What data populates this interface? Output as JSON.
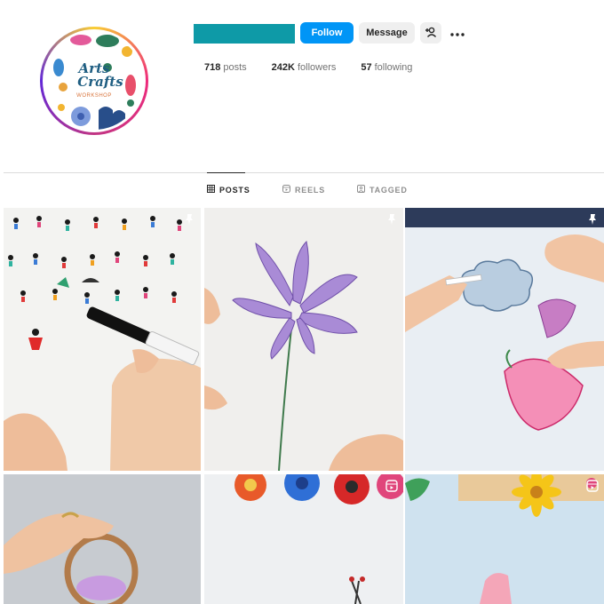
{
  "profile": {
    "avatar_lines": [
      "Arts",
      "Crafts"
    ],
    "avatar_sub": "WORKSHOP",
    "username_color": "#0e9aa7"
  },
  "actions": {
    "follow_label": "Follow",
    "message_label": "Message",
    "add_user_icon": "add-user-icon",
    "more_icon": "more-icon"
  },
  "stats": {
    "posts": {
      "value": "718",
      "label": "posts"
    },
    "followers": {
      "value": "242K",
      "label": "followers"
    },
    "following": {
      "value": "57",
      "label": "following"
    }
  },
  "tabs": [
    {
      "label": "POSTS",
      "icon": "grid-icon",
      "active": true
    },
    {
      "label": "REELS",
      "icon": "reels-icon",
      "active": false
    },
    {
      "label": "TAGGED",
      "icon": "tagged-icon",
      "active": false
    }
  ],
  "posts": [
    {
      "subject": "hand drawing tiny figures with pen",
      "badge": "pin-icon"
    },
    {
      "subject": "purple lily pencil drawing",
      "badge": "pin-icon"
    },
    {
      "subject": "colored pencil clouds and pink flower",
      "badge": "pin-icon"
    },
    {
      "subject": "hand holding paper roll",
      "badge": ""
    },
    {
      "subject": "paper flowers and scissors",
      "badge": "reel-icon"
    },
    {
      "subject": "paper sunflower craft",
      "badge": "reel-icon"
    }
  ],
  "colors": {
    "accent": "#0095f6",
    "text": "#262626",
    "muted": "#737373",
    "divider": "#dbdbdb"
  }
}
